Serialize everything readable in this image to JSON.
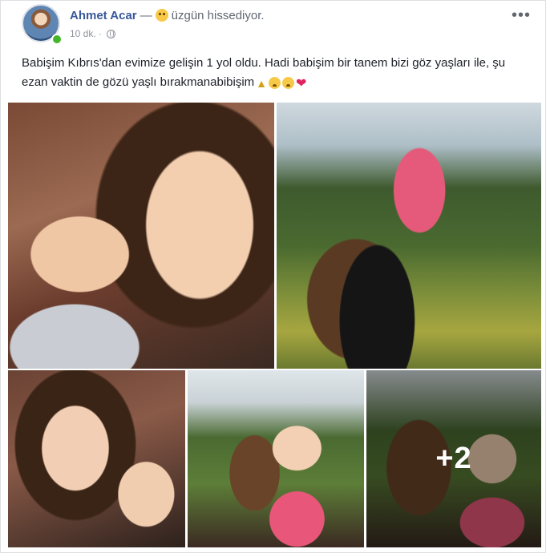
{
  "post": {
    "author": "Ahmet Acar",
    "separator": "—",
    "feeling_icon": "sad-face-icon",
    "feeling": "üzgün hissediyor.",
    "timestamp": "10 dk.",
    "meta_separator": "·",
    "privacy_icon": "globe-icon",
    "more_label": "•••",
    "caption": "Babişim Kıbrıs'dan evimize gelişin 1 yol oldu. Hadi babişim bir tanem bizi göz yaşları ile, şu ezan vaktin de gözü yaşlı bırakmanabibişim",
    "caption_emojis": [
      "folded-hands-icon",
      "sad-face-icon",
      "crying-face-icon",
      "red-heart-icon"
    ]
  },
  "photos": {
    "count_visible": 5,
    "more_overlay": "+2"
  },
  "colors": {
    "author_link": "#385898",
    "online_indicator": "#42b72a",
    "secondary_text": "#90949c",
    "heart": "#e0245e"
  }
}
